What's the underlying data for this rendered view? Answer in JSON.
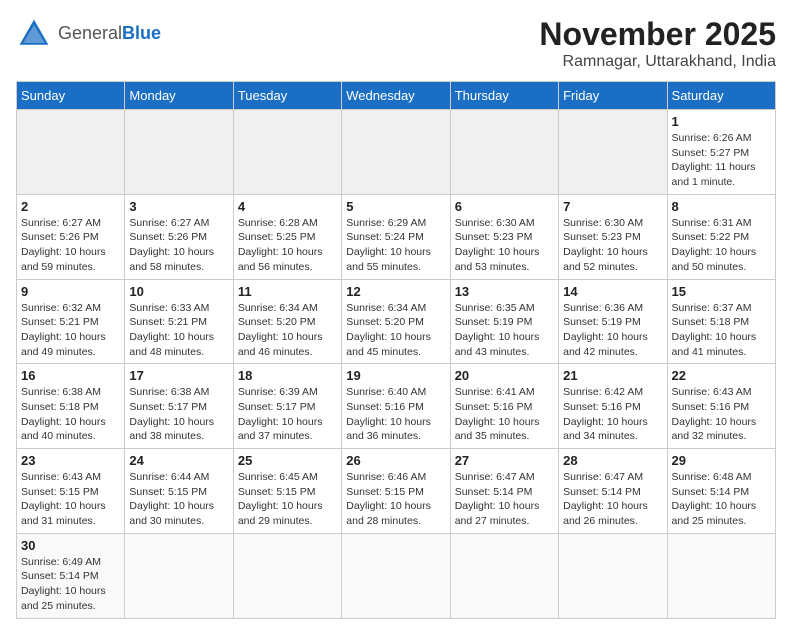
{
  "header": {
    "logo_general": "General",
    "logo_blue": "Blue",
    "month_title": "November 2025",
    "location": "Ramnagar, Uttarakhand, India"
  },
  "weekdays": [
    "Sunday",
    "Monday",
    "Tuesday",
    "Wednesday",
    "Thursday",
    "Friday",
    "Saturday"
  ],
  "days": [
    {
      "date": "",
      "info": ""
    },
    {
      "date": "",
      "info": ""
    },
    {
      "date": "",
      "info": ""
    },
    {
      "date": "",
      "info": ""
    },
    {
      "date": "",
      "info": ""
    },
    {
      "date": "",
      "info": ""
    },
    {
      "date": "1",
      "info": "Sunrise: 6:26 AM\nSunset: 5:27 PM\nDaylight: 11 hours and 1 minute."
    },
    {
      "date": "2",
      "info": "Sunrise: 6:27 AM\nSunset: 5:26 PM\nDaylight: 10 hours and 59 minutes."
    },
    {
      "date": "3",
      "info": "Sunrise: 6:27 AM\nSunset: 5:26 PM\nDaylight: 10 hours and 58 minutes."
    },
    {
      "date": "4",
      "info": "Sunrise: 6:28 AM\nSunset: 5:25 PM\nDaylight: 10 hours and 56 minutes."
    },
    {
      "date": "5",
      "info": "Sunrise: 6:29 AM\nSunset: 5:24 PM\nDaylight: 10 hours and 55 minutes."
    },
    {
      "date": "6",
      "info": "Sunrise: 6:30 AM\nSunset: 5:23 PM\nDaylight: 10 hours and 53 minutes."
    },
    {
      "date": "7",
      "info": "Sunrise: 6:30 AM\nSunset: 5:23 PM\nDaylight: 10 hours and 52 minutes."
    },
    {
      "date": "8",
      "info": "Sunrise: 6:31 AM\nSunset: 5:22 PM\nDaylight: 10 hours and 50 minutes."
    },
    {
      "date": "9",
      "info": "Sunrise: 6:32 AM\nSunset: 5:21 PM\nDaylight: 10 hours and 49 minutes."
    },
    {
      "date": "10",
      "info": "Sunrise: 6:33 AM\nSunset: 5:21 PM\nDaylight: 10 hours and 48 minutes."
    },
    {
      "date": "11",
      "info": "Sunrise: 6:34 AM\nSunset: 5:20 PM\nDaylight: 10 hours and 46 minutes."
    },
    {
      "date": "12",
      "info": "Sunrise: 6:34 AM\nSunset: 5:20 PM\nDaylight: 10 hours and 45 minutes."
    },
    {
      "date": "13",
      "info": "Sunrise: 6:35 AM\nSunset: 5:19 PM\nDaylight: 10 hours and 43 minutes."
    },
    {
      "date": "14",
      "info": "Sunrise: 6:36 AM\nSunset: 5:19 PM\nDaylight: 10 hours and 42 minutes."
    },
    {
      "date": "15",
      "info": "Sunrise: 6:37 AM\nSunset: 5:18 PM\nDaylight: 10 hours and 41 minutes."
    },
    {
      "date": "16",
      "info": "Sunrise: 6:38 AM\nSunset: 5:18 PM\nDaylight: 10 hours and 40 minutes."
    },
    {
      "date": "17",
      "info": "Sunrise: 6:38 AM\nSunset: 5:17 PM\nDaylight: 10 hours and 38 minutes."
    },
    {
      "date": "18",
      "info": "Sunrise: 6:39 AM\nSunset: 5:17 PM\nDaylight: 10 hours and 37 minutes."
    },
    {
      "date": "19",
      "info": "Sunrise: 6:40 AM\nSunset: 5:16 PM\nDaylight: 10 hours and 36 minutes."
    },
    {
      "date": "20",
      "info": "Sunrise: 6:41 AM\nSunset: 5:16 PM\nDaylight: 10 hours and 35 minutes."
    },
    {
      "date": "21",
      "info": "Sunrise: 6:42 AM\nSunset: 5:16 PM\nDaylight: 10 hours and 34 minutes."
    },
    {
      "date": "22",
      "info": "Sunrise: 6:43 AM\nSunset: 5:16 PM\nDaylight: 10 hours and 32 minutes."
    },
    {
      "date": "23",
      "info": "Sunrise: 6:43 AM\nSunset: 5:15 PM\nDaylight: 10 hours and 31 minutes."
    },
    {
      "date": "24",
      "info": "Sunrise: 6:44 AM\nSunset: 5:15 PM\nDaylight: 10 hours and 30 minutes."
    },
    {
      "date": "25",
      "info": "Sunrise: 6:45 AM\nSunset: 5:15 PM\nDaylight: 10 hours and 29 minutes."
    },
    {
      "date": "26",
      "info": "Sunrise: 6:46 AM\nSunset: 5:15 PM\nDaylight: 10 hours and 28 minutes."
    },
    {
      "date": "27",
      "info": "Sunrise: 6:47 AM\nSunset: 5:14 PM\nDaylight: 10 hours and 27 minutes."
    },
    {
      "date": "28",
      "info": "Sunrise: 6:47 AM\nSunset: 5:14 PM\nDaylight: 10 hours and 26 minutes."
    },
    {
      "date": "29",
      "info": "Sunrise: 6:48 AM\nSunset: 5:14 PM\nDaylight: 10 hours and 25 minutes."
    },
    {
      "date": "30",
      "info": "Sunrise: 6:49 AM\nSunset: 5:14 PM\nDaylight: 10 hours and 25 minutes."
    },
    {
      "date": "",
      "info": ""
    },
    {
      "date": "",
      "info": ""
    },
    {
      "date": "",
      "info": ""
    },
    {
      "date": "",
      "info": ""
    },
    {
      "date": "",
      "info": ""
    },
    {
      "date": "",
      "info": ""
    }
  ]
}
